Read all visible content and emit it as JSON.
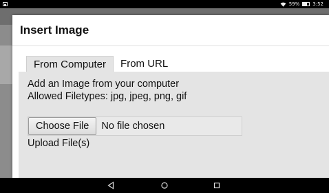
{
  "status_bar": {
    "battery_percent": "59%",
    "battery_level": 0.59,
    "time": "3:52"
  },
  "dialog": {
    "title": "Insert Image",
    "tabs": [
      {
        "label": "From Computer",
        "active": true
      },
      {
        "label": "From URL",
        "active": false
      }
    ],
    "panel": {
      "line1": "Add an Image from your computer",
      "line2": "Allowed Filetypes: jpg, jpeg, png, gif",
      "choose_file_label": "Choose File",
      "file_status": "No file chosen",
      "upload_label": "Upload File(s)"
    }
  },
  "nav": {
    "back_icon": "back-triangle-icon",
    "home_icon": "home-circle-icon",
    "recents_icon": "recents-square-icon"
  }
}
